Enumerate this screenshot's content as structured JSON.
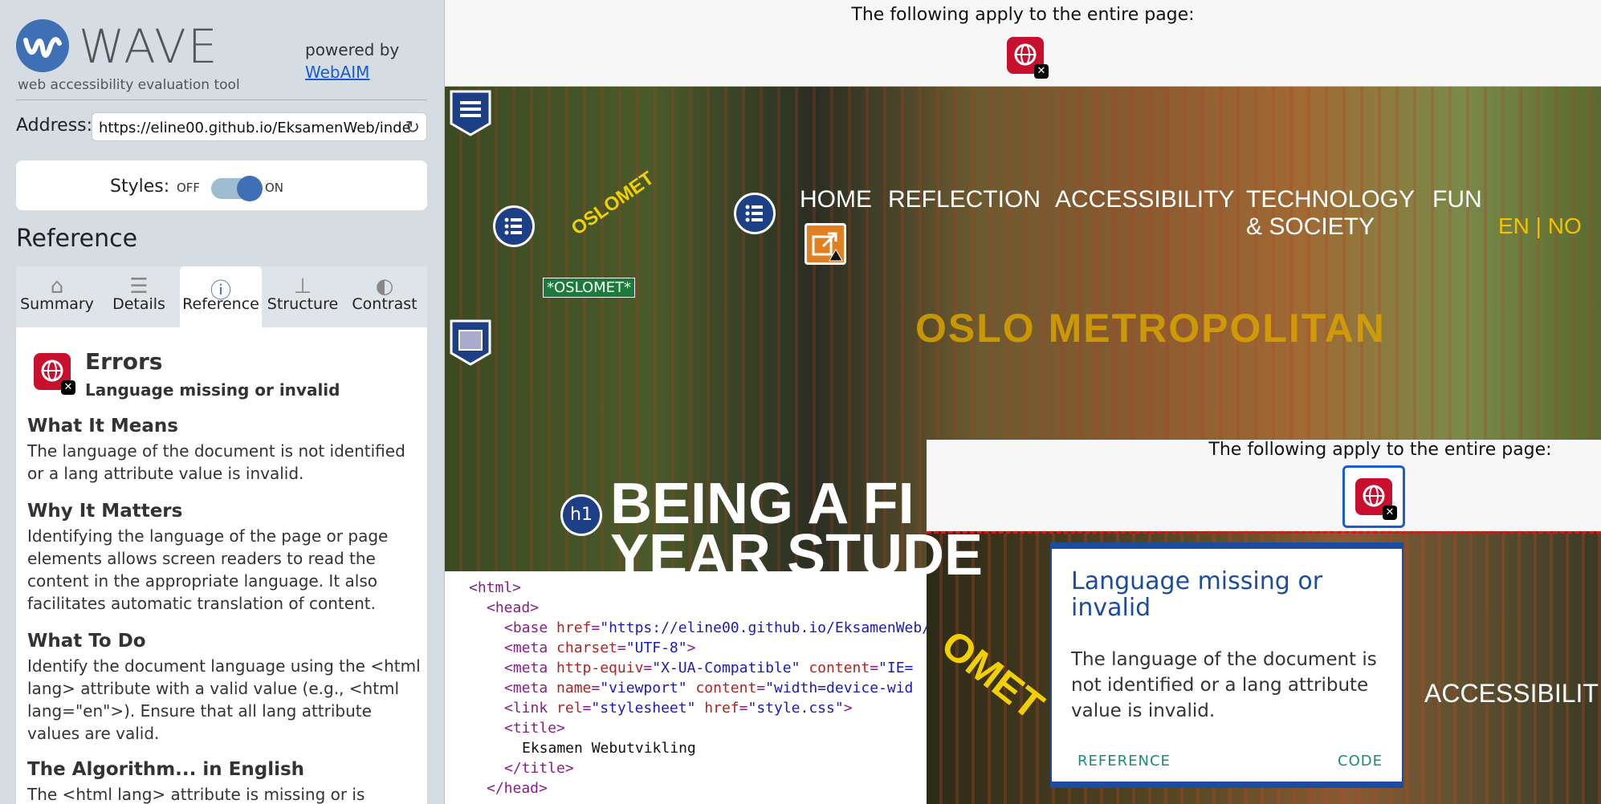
{
  "wave": {
    "title": "WAVE",
    "subtitle": "web accessibility evaluation tool",
    "powered_by": "powered by",
    "webaim_link": "WebAIM",
    "address_label": "Address:",
    "address_value": "https://eline00.github.io/EksamenWeb/inde",
    "styles_label": "Styles:",
    "styles_off": "OFF",
    "styles_on": "ON",
    "reference_heading": "Reference",
    "tabs": [
      {
        "label": "Summary",
        "icon": "home-icon"
      },
      {
        "label": "Details",
        "icon": "list-icon"
      },
      {
        "label": "Reference",
        "icon": "info-icon"
      },
      {
        "label": "Structure",
        "icon": "structure-icon"
      },
      {
        "label": "Contrast",
        "icon": "contrast-icon"
      }
    ],
    "active_tab": "Reference",
    "error": {
      "category": "Errors",
      "name": "Language missing or invalid"
    },
    "sections": [
      {
        "heading": "What It Means",
        "text": "The language of the document is not identified or a lang attribute value is invalid."
      },
      {
        "heading": "Why It Matters",
        "text": "Identifying the language of the page or page elements allows screen readers to read the content in the appropriate language. It also facilitates automatic translation of content."
      },
      {
        "heading": "What To Do",
        "text": "Identify the document language using the <html lang> attribute with a valid value (e.g., <html lang=\"en\">). Ensure that all lang attribute values are valid."
      },
      {
        "heading": "The Algorithm... in English",
        "text": "The <html lang> attribute is missing or is empty."
      }
    ]
  },
  "page": {
    "banner_text": "The following apply to the entire page:",
    "nav": [
      {
        "label": "HOME"
      },
      {
        "label": "REFLECTION"
      },
      {
        "label": "ACCESSIBILITY"
      },
      {
        "label": "TECHNOLOGY\n& SOCIETY"
      },
      {
        "label": "FUN"
      }
    ],
    "lang_switch": "EN | NO",
    "logo_text": "OSLOMET",
    "logo_alt_tag": "*OSLOMET*",
    "metro_title": "OSLO METROPOLITAN",
    "h1_badge": "h1",
    "hero_heading_line1": "BEING A FI",
    "hero_heading_line2": "YEAR STUDE"
  },
  "code": {
    "lines": [
      {
        "indent": 0,
        "parts": [
          [
            "tag",
            "<html>"
          ]
        ]
      },
      {
        "indent": 1,
        "parts": [
          [
            "tag",
            "<head>"
          ]
        ]
      },
      {
        "indent": 2,
        "parts": [
          [
            "tag",
            "<base "
          ],
          [
            "attr",
            "href"
          ],
          [
            "tag",
            "="
          ],
          [
            "val",
            "\"https://eline00.github.io/EksamenWeb/"
          ]
        ]
      },
      {
        "indent": 2,
        "parts": [
          [
            "tag",
            "<meta "
          ],
          [
            "attr",
            "charset"
          ],
          [
            "tag",
            "="
          ],
          [
            "val",
            "\"UTF-8\""
          ],
          [
            "tag",
            ">"
          ]
        ]
      },
      {
        "indent": 2,
        "parts": [
          [
            "tag",
            "<meta "
          ],
          [
            "attr",
            "http-equiv"
          ],
          [
            "tag",
            "="
          ],
          [
            "val",
            "\"X-UA-Compatible\""
          ],
          [
            "tag",
            " "
          ],
          [
            "attr",
            "content"
          ],
          [
            "tag",
            "="
          ],
          [
            "val",
            "\"IE="
          ]
        ]
      },
      {
        "indent": 2,
        "parts": [
          [
            "tag",
            "<meta "
          ],
          [
            "attr",
            "name"
          ],
          [
            "tag",
            "="
          ],
          [
            "val",
            "\"viewport\""
          ],
          [
            "tag",
            " "
          ],
          [
            "attr",
            "content"
          ],
          [
            "tag",
            "="
          ],
          [
            "val",
            "\"width=device-wid"
          ]
        ]
      },
      {
        "indent": 2,
        "parts": [
          [
            "tag",
            "<link "
          ],
          [
            "attr",
            "rel"
          ],
          [
            "tag",
            "="
          ],
          [
            "val",
            "\"stylesheet\""
          ],
          [
            "tag",
            " "
          ],
          [
            "attr",
            "href"
          ],
          [
            "tag",
            "="
          ],
          [
            "val",
            "\"style.css\""
          ],
          [
            "tag",
            ">"
          ]
        ]
      },
      {
        "indent": 2,
        "parts": [
          [
            "tag",
            "<title>"
          ]
        ]
      },
      {
        "indent": 3,
        "parts": [
          [
            "txt",
            "Eksamen Webutvikling"
          ]
        ]
      },
      {
        "indent": 2,
        "parts": [
          [
            "tag",
            "</title>"
          ]
        ]
      },
      {
        "indent": 1,
        "parts": [
          [
            "tag",
            "</head>"
          ]
        ]
      }
    ]
  },
  "inset": {
    "banner_text": "The following apply to the entire page:",
    "nav_fragment": "ACCESSIBILIT",
    "logo_fragment": "OMET",
    "popup": {
      "title": "Language missing or invalid",
      "body": "The language of the document is not identified or a lang attribute value is invalid.",
      "reference_link": "REFERENCE",
      "code_link": "CODE"
    }
  },
  "colors": {
    "wave_blue": "#3f6fb5",
    "error_red": "#c8102e",
    "popup_blue": "#1c4c9f",
    "link_teal": "#1c8a7a",
    "logo_yellow": "#f2d000"
  }
}
